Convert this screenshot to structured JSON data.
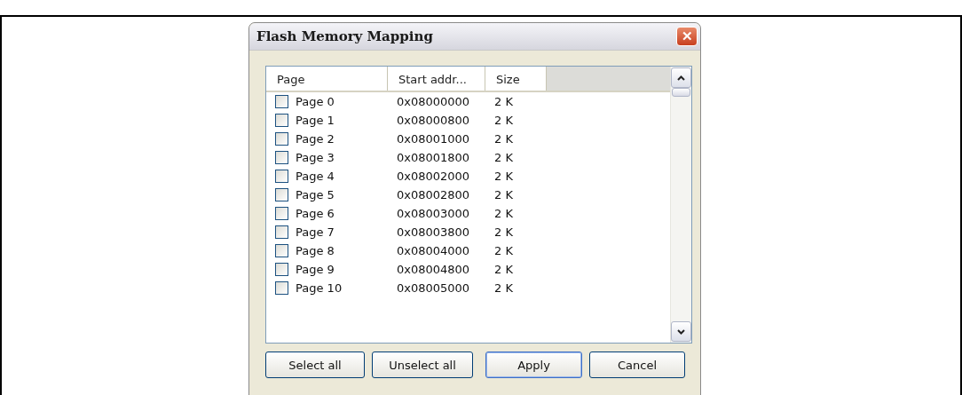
{
  "window": {
    "title": "Flash Memory Mapping",
    "close": "✕"
  },
  "table": {
    "columns": [
      "Page",
      "Start addr...",
      "Size"
    ],
    "rows": [
      {
        "page": "Page 0",
        "start": "0x08000000",
        "size": "2 K",
        "checked": false
      },
      {
        "page": "Page 1",
        "start": "0x08000800",
        "size": "2 K",
        "checked": false
      },
      {
        "page": "Page 2",
        "start": "0x08001000",
        "size": "2 K",
        "checked": false
      },
      {
        "page": "Page 3",
        "start": "0x08001800",
        "size": "2 K",
        "checked": false
      },
      {
        "page": "Page 4",
        "start": "0x08002000",
        "size": "2 K",
        "checked": false
      },
      {
        "page": "Page 5",
        "start": "0x08002800",
        "size": "2 K",
        "checked": false
      },
      {
        "page": "Page 6",
        "start": "0x08003000",
        "size": "2 K",
        "checked": false
      },
      {
        "page": "Page 7",
        "start": "0x08003800",
        "size": "2 K",
        "checked": false
      },
      {
        "page": "Page 8",
        "start": "0x08004000",
        "size": "2 K",
        "checked": false
      },
      {
        "page": "Page 9",
        "start": "0x08004800",
        "size": "2 K",
        "checked": false
      },
      {
        "page": "Page 10",
        "start": "0x08005000",
        "size": "2 K",
        "checked": false
      }
    ]
  },
  "buttons": [
    {
      "label": "Select all",
      "default": false
    },
    {
      "label": "Unselect all",
      "default": false
    },
    {
      "label": "Apply",
      "default": true
    },
    {
      "label": "Cancel",
      "default": false
    }
  ]
}
